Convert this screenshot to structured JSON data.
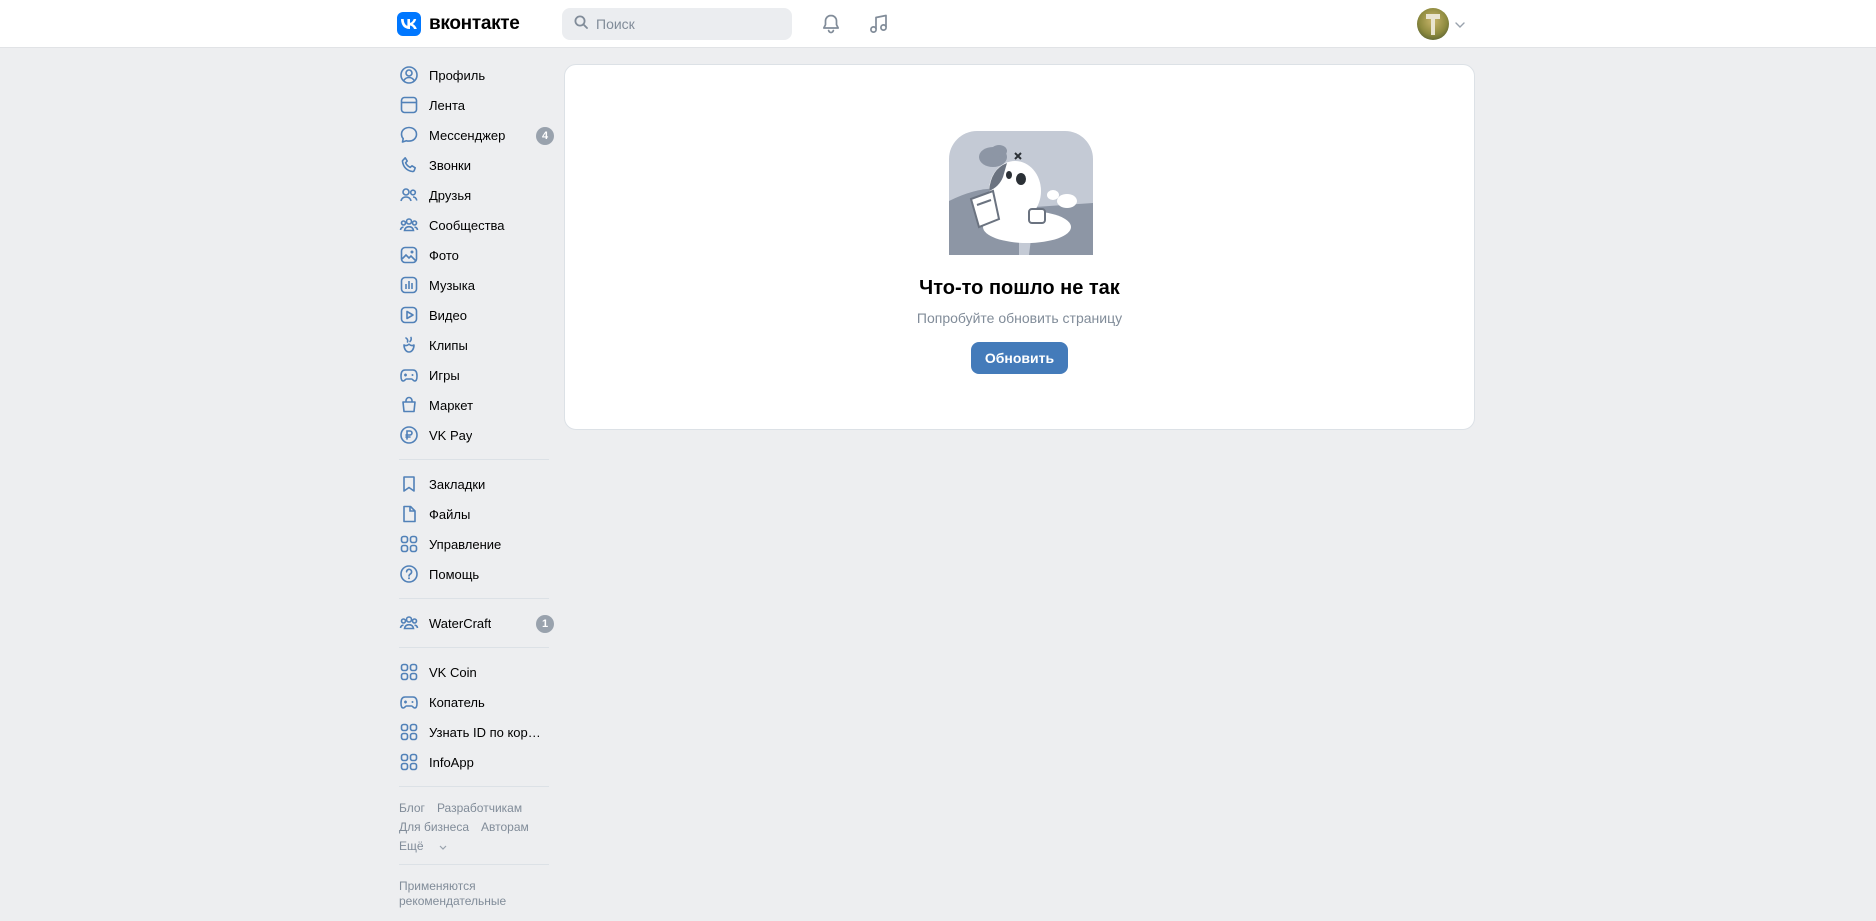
{
  "header": {
    "logo_text": "вконтакте",
    "search_placeholder": "Поиск",
    "icons": [
      "bell-icon",
      "music-note-icon"
    ],
    "accent_color": "#0077ff"
  },
  "sidebar": {
    "group1": [
      {
        "label": "Профиль",
        "icon": "user-circle-icon"
      },
      {
        "label": "Лента",
        "icon": "newsfeed-icon"
      },
      {
        "label": "Мессенджер",
        "icon": "message-icon",
        "badge": "4"
      },
      {
        "label": "Звонки",
        "icon": "phone-icon"
      },
      {
        "label": "Друзья",
        "icon": "friends-icon"
      },
      {
        "label": "Сообщества",
        "icon": "communities-icon"
      },
      {
        "label": "Фото",
        "icon": "photo-icon"
      },
      {
        "label": "Музыка",
        "icon": "music-icon"
      },
      {
        "label": "Видео",
        "icon": "video-icon"
      },
      {
        "label": "Клипы",
        "icon": "clips-icon"
      },
      {
        "label": "Игры",
        "icon": "gamepad-icon"
      },
      {
        "label": "Маркет",
        "icon": "market-icon"
      },
      {
        "label": "VK Pay",
        "icon": "vkpay-icon"
      }
    ],
    "group2": [
      {
        "label": "Закладки",
        "icon": "bookmark-icon"
      },
      {
        "label": "Файлы",
        "icon": "file-icon"
      },
      {
        "label": "Управление",
        "icon": "apps-grid-icon"
      },
      {
        "label": "Помощь",
        "icon": "help-icon"
      }
    ],
    "group3": [
      {
        "label": "WaterCraft",
        "icon": "communities-icon",
        "badge": "1"
      }
    ],
    "group4": [
      {
        "label": "VK Coin",
        "icon": "apps-grid-icon"
      },
      {
        "label": "Копатель",
        "icon": "gamepad-icon"
      },
      {
        "label": "Узнать ID по короткому имени",
        "icon": "apps-grid-icon"
      },
      {
        "label": "InfoApp",
        "icon": "apps-grid-icon"
      }
    ],
    "footer": {
      "blog": "Блог",
      "developers": "Разработчикам",
      "business": "Для бизнеса",
      "authors": "Авторам",
      "more": "Ещё",
      "note_line1": "Применяются",
      "note_line2": "рекомендательные"
    }
  },
  "main": {
    "error_title": "Что-то пошло не так",
    "error_subtitle": "Попробуйте обновить страницу",
    "refresh_label": "Обновить",
    "button_color": "#447bba"
  }
}
